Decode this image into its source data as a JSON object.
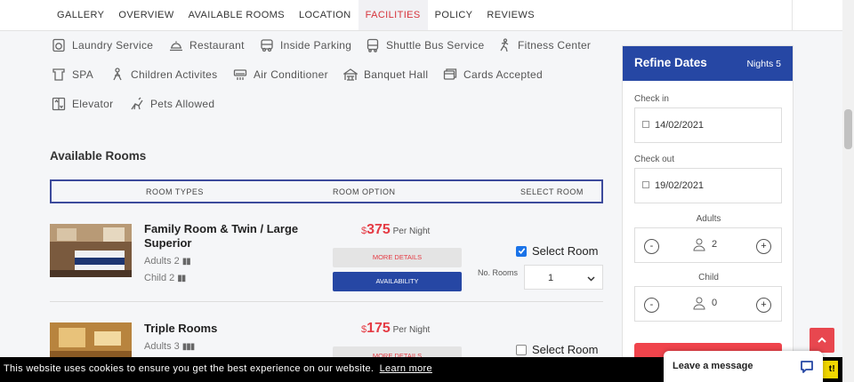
{
  "nav": {
    "tabs": [
      "GALLERY",
      "OVERVIEW",
      "AVAILABLE ROOMS",
      "LOCATION",
      "FACILITIES",
      "POLICY",
      "REVIEWS"
    ],
    "active": "FACILITIES"
  },
  "facilities": [
    {
      "label": "Laundry Service",
      "icon": "laundry-icon"
    },
    {
      "label": "Restaurant",
      "icon": "restaurant-icon"
    },
    {
      "label": "Inside Parking",
      "icon": "parking-icon"
    },
    {
      "label": "Shuttle Bus Service",
      "icon": "bus-icon"
    },
    {
      "label": "Fitness Center",
      "icon": "fitness-icon"
    },
    {
      "label": "SPA",
      "icon": "spa-icon"
    },
    {
      "label": "Children Activites",
      "icon": "children-icon"
    },
    {
      "label": "Air Conditioner",
      "icon": "ac-icon"
    },
    {
      "label": "Banquet Hall",
      "icon": "banquet-icon"
    },
    {
      "label": "Cards Accepted",
      "icon": "card-icon"
    },
    {
      "label": "Elevator",
      "icon": "elevator-icon"
    },
    {
      "label": "Pets Allowed",
      "icon": "pet-icon"
    }
  ],
  "available_rooms": {
    "title": "Available Rooms",
    "headers": {
      "room_types": "ROOM TYPES",
      "room_option": "ROOM OPTION",
      "select_room": "SELECT ROOM"
    },
    "rooms": [
      {
        "name": "Family Room & Twin / Large Superior",
        "adults": "Adults 2",
        "child": "Child 2",
        "currency": "$",
        "price": "375",
        "per": "Per Night",
        "more_details": "MORE DETAILS",
        "availability": "AVAILABILITY",
        "select_label": "Select Room",
        "selected": true,
        "no_rooms_label": "No. Rooms",
        "no_rooms_value": "1"
      },
      {
        "name": "Triple Rooms",
        "adults": "Adults 3",
        "currency": "$",
        "price": "175",
        "per": "Per Night",
        "more_details": "MORE DETAILS",
        "select_label": "Select Room",
        "selected": false
      }
    ]
  },
  "refine": {
    "title": "Refine Dates",
    "nights": "Nights 5",
    "checkin_label": "Check in",
    "checkin": "14/02/2021",
    "checkout_label": "Check out",
    "checkout": "19/02/2021",
    "adults_label": "Adults",
    "adults": "2",
    "child_label": "Child",
    "child": "0",
    "minus": "-",
    "plus": "+"
  },
  "cookie": {
    "message": "This website uses cookies to ensure you get the best experience on our website.",
    "learn_more": "Learn more",
    "got_it": "t!"
  },
  "chat": {
    "label": "Leave a message"
  },
  "colors": {
    "primary": "#2647a4",
    "accent": "#e53b44"
  }
}
